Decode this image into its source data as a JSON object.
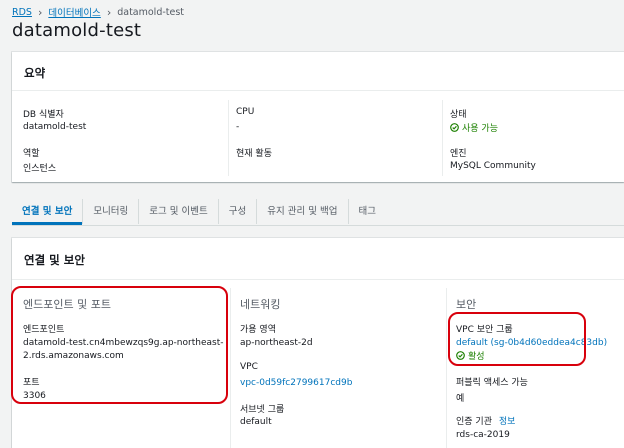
{
  "breadcrumb": {
    "root": "RDS",
    "databases": "데이터베이스",
    "current": "datamold-test"
  },
  "page_title": "datamold-test",
  "summary": {
    "header": "요약",
    "db_identifier_label": "DB 식별자",
    "db_identifier_value": "datamold-test",
    "cpu_label": "CPU",
    "cpu_value": "-",
    "status_label": "상태",
    "status_value": "사용 가능",
    "role_label": "역할",
    "role_value": "인스턴스",
    "current_activity_label": "현재 활동",
    "engine_label": "엔진",
    "engine_value": "MySQL Community"
  },
  "tabs": [
    {
      "label": "연결 및 보안",
      "active": true
    },
    {
      "label": "모니터링",
      "active": false
    },
    {
      "label": "로그 및 이벤트",
      "active": false
    },
    {
      "label": "구성",
      "active": false
    },
    {
      "label": "유지 관리 및 백업",
      "active": false
    },
    {
      "label": "태그",
      "active": false
    }
  ],
  "connectivity": {
    "header": "연결 및 보안",
    "endpoint_section": {
      "title": "엔드포인트 및 포트",
      "endpoint_label": "엔드포인트",
      "endpoint_line1": "datamold-test.cn4mbewzqs9g.ap-northeast-",
      "endpoint_line2": "2.rds.amazonaws.com",
      "port_label": "포트",
      "port_value": "3306"
    },
    "networking_section": {
      "title": "네트워킹",
      "az_label": "가용 영역",
      "az_value": "ap-northeast-2d",
      "vpc_label": "VPC",
      "vpc_value": "vpc-0d59fc2799617cd9b",
      "subnet_group_label": "서브넷 그룹",
      "subnet_group_value": "default"
    },
    "security_section": {
      "title": "보안",
      "vpc_sg_label": "VPC 보안 그룹",
      "vpc_sg_value": "default (sg-0b4d60eddea4c83db)",
      "sg_status": "활성",
      "public_access_label": "퍼블릭 액세스 가능",
      "public_access_value": "예",
      "ca_label": "인증 기관",
      "ca_info": "정보",
      "ca_value": "rds-ca-2019"
    }
  },
  "colors": {
    "link": "#0073bb",
    "success": "#1d8102",
    "highlight": "#d8000c"
  }
}
